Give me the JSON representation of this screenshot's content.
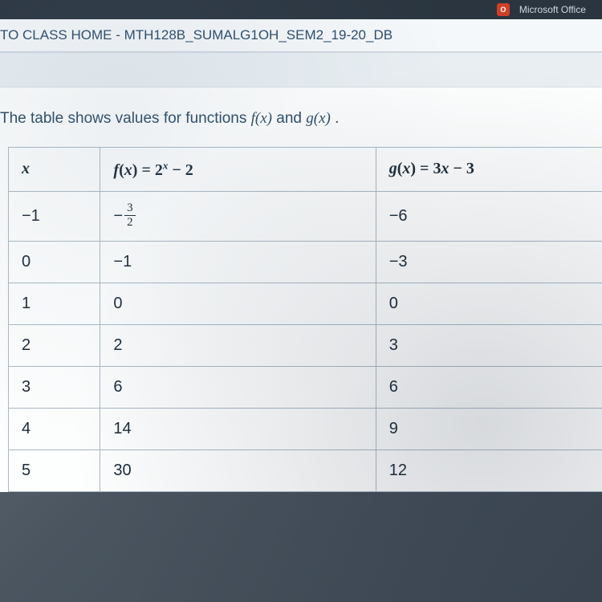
{
  "topbar": {
    "office_label": "Microsoft Office"
  },
  "breadcrumb": "TO CLASS HOME - MTH128B_SUMALG1OH_SEM2_19-20_DB",
  "prompt": {
    "prefix": "The table shows values for functions ",
    "f_label": "f(x)",
    "mid": " and ",
    "g_label": "g(x)",
    "suffix": " ."
  },
  "chart_data": {
    "type": "table",
    "headers": {
      "x": "x",
      "f_expr": "f(x) = 2^x − 2",
      "g_expr": "g(x) = 3x − 3"
    },
    "rows": [
      {
        "x": "−1",
        "f": "−3/2",
        "g": "−6"
      },
      {
        "x": "0",
        "f": "−1",
        "g": "−3"
      },
      {
        "x": "1",
        "f": "0",
        "g": "0"
      },
      {
        "x": "2",
        "f": "2",
        "g": "3"
      },
      {
        "x": "3",
        "f": "6",
        "g": "6"
      },
      {
        "x": "4",
        "f": "14",
        "g": "9"
      },
      {
        "x": "5",
        "f": "30",
        "g": "12"
      }
    ]
  }
}
